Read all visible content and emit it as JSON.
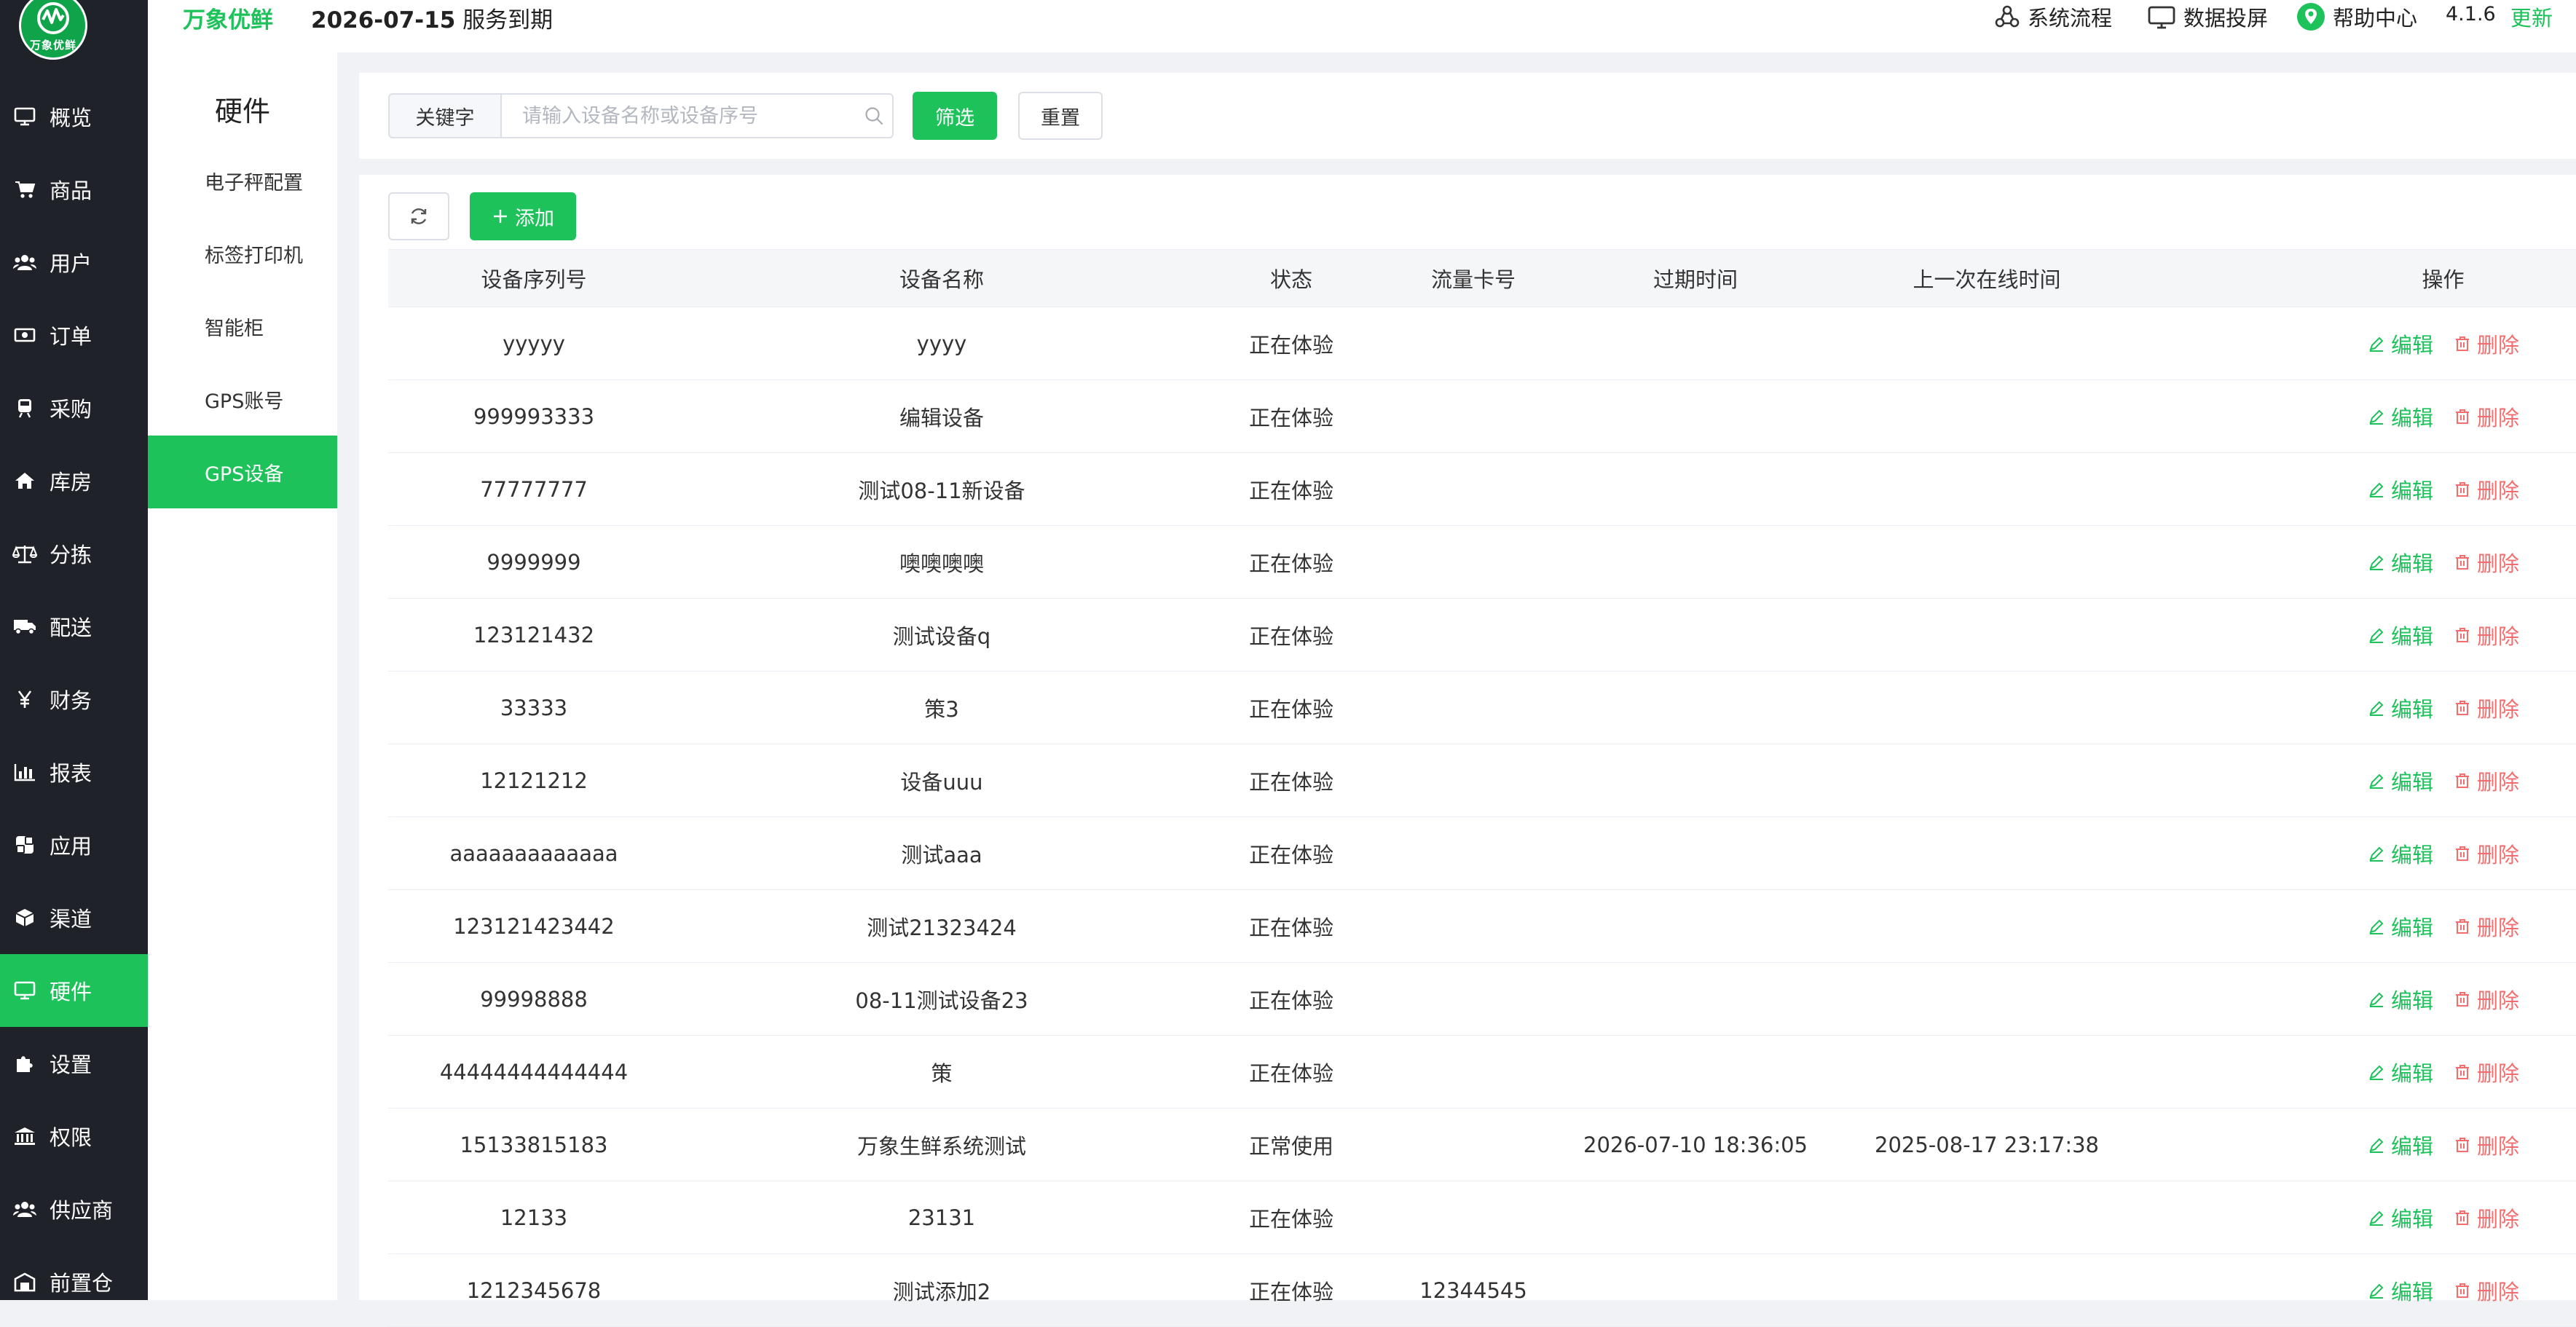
{
  "brand": {
    "logo_text": "万象优鲜",
    "name": "万象优鲜"
  },
  "header": {
    "expire_date": "2026-07-15",
    "expire_text": "服务到期",
    "tools": [
      {
        "label": "系统流程",
        "icon": "flow-icon"
      },
      {
        "label": "数据投屏",
        "icon": "screen-icon"
      },
      {
        "label": "帮助中心",
        "icon": "help-location-icon"
      }
    ],
    "version": "4.1.6",
    "update_label": "更新"
  },
  "sidebar": {
    "items": [
      {
        "label": "概览",
        "icon": "monitor-icon"
      },
      {
        "label": "商品",
        "icon": "cart-icon"
      },
      {
        "label": "用户",
        "icon": "users-icon"
      },
      {
        "label": "订单",
        "icon": "money-icon"
      },
      {
        "label": "采购",
        "icon": "train-icon"
      },
      {
        "label": "库房",
        "icon": "home-icon"
      },
      {
        "label": "分拣",
        "icon": "scale-icon"
      },
      {
        "label": "配送",
        "icon": "truck-icon"
      },
      {
        "label": "财务",
        "icon": "yen-icon"
      },
      {
        "label": "报表",
        "icon": "bar-chart-icon"
      },
      {
        "label": "应用",
        "icon": "apps-icon"
      },
      {
        "label": "渠道",
        "icon": "cube-icon"
      },
      {
        "label": "硬件",
        "icon": "desktop-icon",
        "active": true
      },
      {
        "label": "设置",
        "icon": "puzzle-icon"
      },
      {
        "label": "权限",
        "icon": "bank-icon"
      },
      {
        "label": "供应商",
        "icon": "users-icon"
      },
      {
        "label": "前置仓",
        "icon": "warehouse-icon"
      }
    ]
  },
  "subnav": {
    "title": "硬件",
    "items": [
      {
        "label": "电子秤配置"
      },
      {
        "label": "标签打印机"
      },
      {
        "label": "智能柜"
      },
      {
        "label": "GPS账号"
      },
      {
        "label": "GPS设备",
        "active": true
      }
    ]
  },
  "filter": {
    "keyword_label": "关键字",
    "keyword_placeholder": "请输入设备名称或设备序号",
    "filter_button": "筛选",
    "reset_button": "重置"
  },
  "toolbar": {
    "add_button": "添加"
  },
  "table": {
    "columns": [
      "设备序列号",
      "设备名称",
      "状态",
      "流量卡号",
      "过期时间",
      "上一次在线时间",
      "操作"
    ],
    "edit_label": "编辑",
    "delete_label": "删除",
    "rows": [
      {
        "serial": "yyyyy",
        "name": "yyyy",
        "status": "正在体验",
        "card": "",
        "expire": "",
        "last_online": ""
      },
      {
        "serial": "999993333",
        "name": "编辑设备",
        "status": "正在体验",
        "card": "",
        "expire": "",
        "last_online": ""
      },
      {
        "serial": "77777777",
        "name": "测试08-11新设备",
        "status": "正在体验",
        "card": "",
        "expire": "",
        "last_online": ""
      },
      {
        "serial": "9999999",
        "name": "噢噢噢噢",
        "status": "正在体验",
        "card": "",
        "expire": "",
        "last_online": ""
      },
      {
        "serial": "123121432",
        "name": "测试设备q",
        "status": "正在体验",
        "card": "",
        "expire": "",
        "last_online": ""
      },
      {
        "serial": "33333",
        "name": "策3",
        "status": "正在体验",
        "card": "",
        "expire": "",
        "last_online": ""
      },
      {
        "serial": "12121212",
        "name": "设备uuu",
        "status": "正在体验",
        "card": "",
        "expire": "",
        "last_online": ""
      },
      {
        "serial": "aaaaaaaaaaaaa",
        "name": "测试aaa",
        "status": "正在体验",
        "card": "",
        "expire": "",
        "last_online": ""
      },
      {
        "serial": "123121423442",
        "name": "测试21323424",
        "status": "正在体验",
        "card": "",
        "expire": "",
        "last_online": ""
      },
      {
        "serial": "99998888",
        "name": "08-11测试设备23",
        "status": "正在体验",
        "card": "",
        "expire": "",
        "last_online": ""
      },
      {
        "serial": "44444444444444",
        "name": "策",
        "status": "正在体验",
        "card": "",
        "expire": "",
        "last_online": ""
      },
      {
        "serial": "15133815183",
        "name": "万象生鲜系统测试",
        "status": "正常使用",
        "card": "",
        "expire": "2026-07-10 18:36:05",
        "last_online": "2025-08-17 23:17:38"
      },
      {
        "serial": "12133",
        "name": "23131",
        "status": "正在体验",
        "card": "",
        "expire": "",
        "last_online": ""
      },
      {
        "serial": "1212345678",
        "name": "测试添加2",
        "status": "正在体验",
        "card": "12344545",
        "expire": "",
        "last_online": ""
      }
    ]
  },
  "colors": {
    "accent": "#1ec25a",
    "sidebar_bg": "#1f2329",
    "danger": "#f56c6c"
  }
}
